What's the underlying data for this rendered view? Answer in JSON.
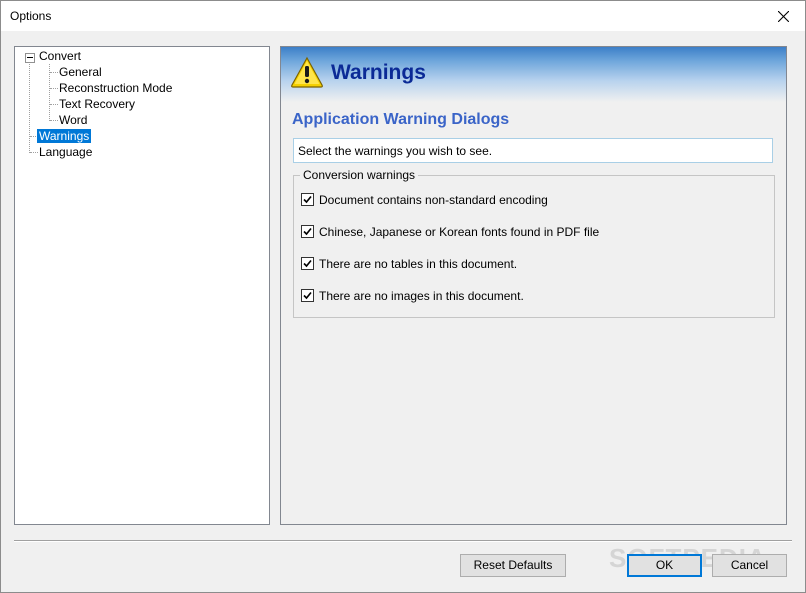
{
  "window": {
    "title": "Options"
  },
  "tree": {
    "root": "Convert",
    "children": [
      "General",
      "Reconstruction Mode",
      "Text Recovery",
      "Word"
    ],
    "siblings": [
      "Warnings",
      "Language"
    ],
    "selected": "Warnings"
  },
  "panel": {
    "banner_title": "Warnings",
    "section_title": "Application Warning Dialogs",
    "instruction": "Select the warnings you wish to see.",
    "group_title": "Conversion warnings",
    "warnings": [
      {
        "label": "Document contains non-standard encoding",
        "checked": true
      },
      {
        "label": "Chinese, Japanese or Korean fonts found in PDF file",
        "checked": true
      },
      {
        "label": "There are no tables in this document.",
        "checked": true
      },
      {
        "label": "There are no images in this document.",
        "checked": true
      }
    ]
  },
  "buttons": {
    "reset": "Reset Defaults",
    "ok": "OK",
    "cancel": "Cancel"
  },
  "watermark": "SOFTPEDIA",
  "colors": {
    "selection": "#0078d7",
    "banner_title": "#0b2a96",
    "section_title": "#3a64c8"
  }
}
